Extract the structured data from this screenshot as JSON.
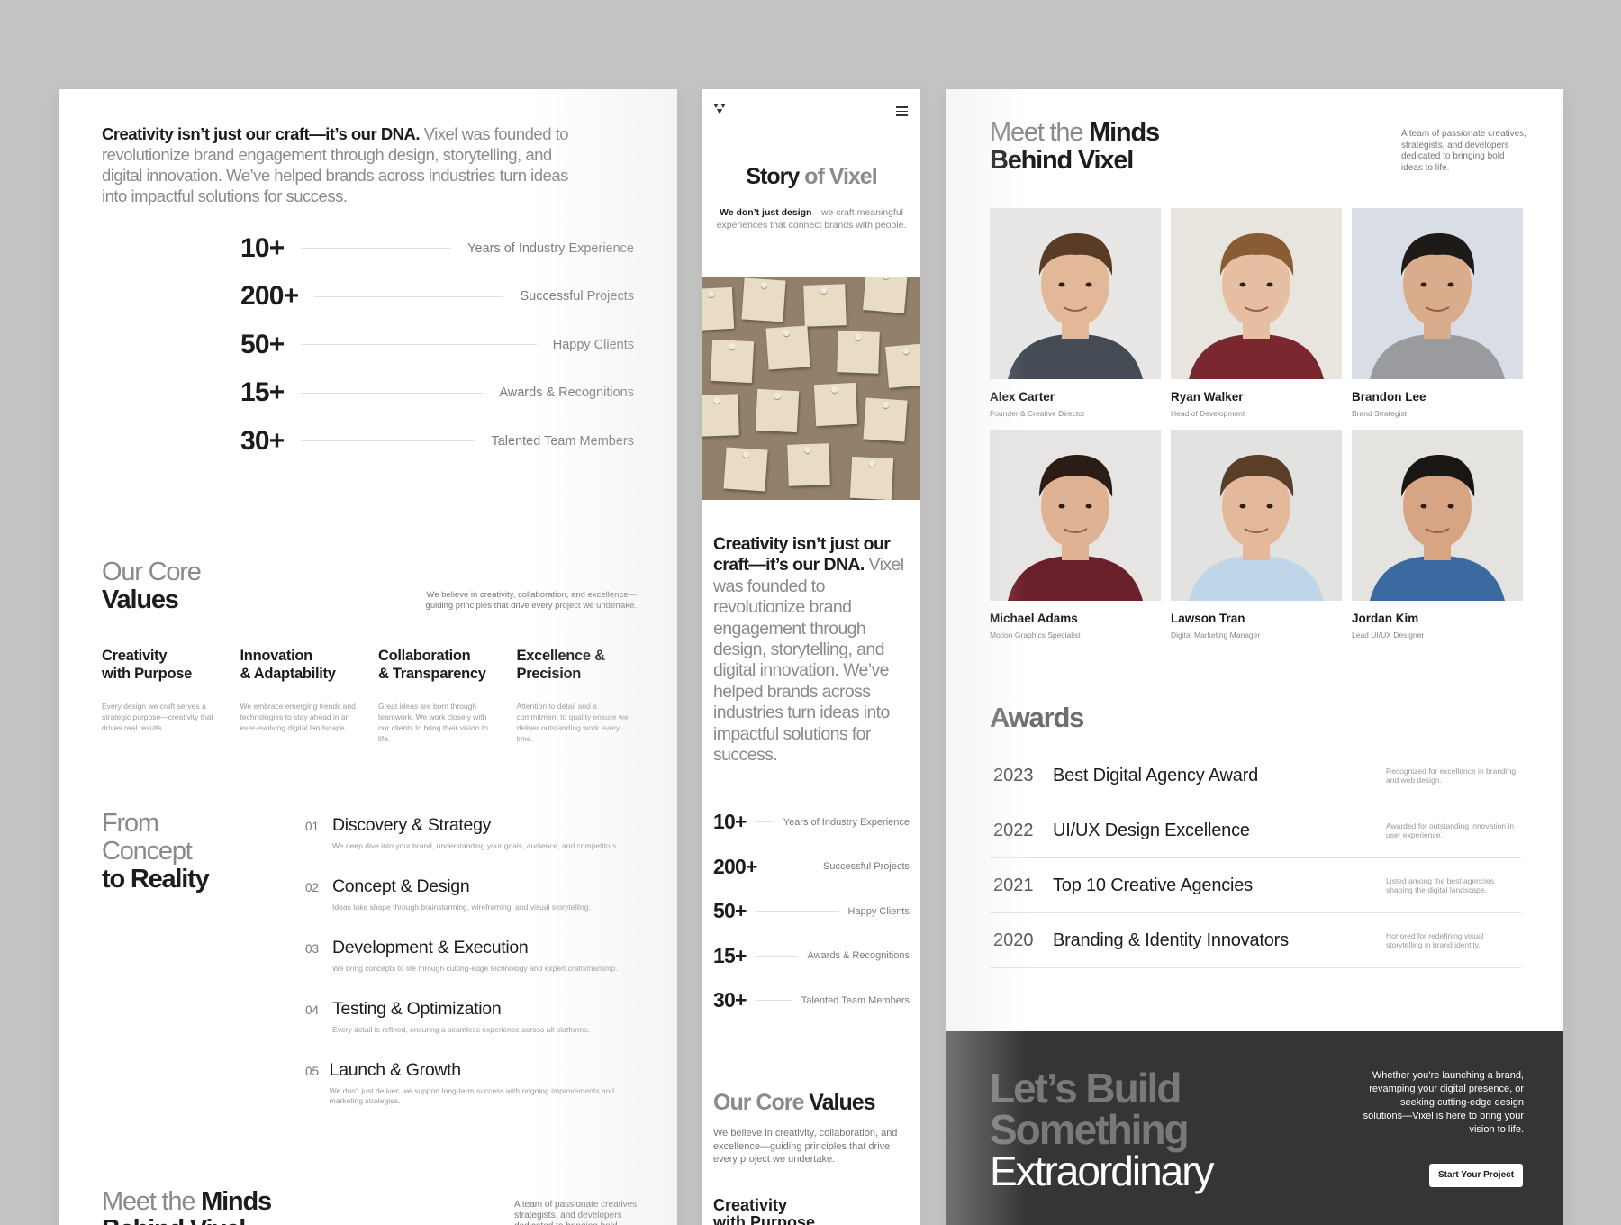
{
  "intro": {
    "bold": "Creativity isn’t just our craft—it’s our DNA.",
    "rest": " Vixel was founded to revolutionize brand engagement through design, storytelling, and digital innovation. We’ve helped brands across industries turn ideas into impactful solutions for success."
  },
  "stats": [
    {
      "value": "10+",
      "label": "Years of Industry Experience"
    },
    {
      "value": "200+",
      "label": "Successful Projects"
    },
    {
      "value": "50+",
      "label": "Happy Clients"
    },
    {
      "value": "15+",
      "label": "Awards & Recognitions"
    },
    {
      "value": "30+",
      "label": "Talented Team Members"
    }
  ],
  "core": {
    "title_light": "Our Core",
    "title_dark": "Values",
    "description": "We believe in creativity, collaboration, and excellence—guiding principles that drive every project we undertake.",
    "values": [
      {
        "line1": "Creativity",
        "line2": "with Purpose",
        "desc": "Every design we craft serves a strategic purpose—creativity that drives real results."
      },
      {
        "line1": "Innovation",
        "line2": "& Adaptability",
        "desc": "We embrace emerging trends and technologies to stay ahead in an ever-evolving digital landscape."
      },
      {
        "line1": "Collaboration",
        "line2": "& Transparency",
        "desc": "Great ideas are born through teamwork. We work closely with our clients to bring their vision to life."
      },
      {
        "line1": "Excellence &",
        "line2": "Precision",
        "desc": "Attention to detail and a commitment to quality ensure we deliver outstanding work every time."
      }
    ]
  },
  "process": {
    "title_l1": "From",
    "title_l2": "Concept",
    "title_l3": "to Reality",
    "steps": [
      {
        "num": "01",
        "title": "Discovery & Strategy",
        "desc": "We deep dive into your brand, understanding your goals, audience, and competitors."
      },
      {
        "num": "02",
        "title": "Concept & Design",
        "desc": "Ideas take shape through brainstorming, wireframing, and visual storytelling."
      },
      {
        "num": "03",
        "title": "Development & Execution",
        "desc": "We bring concepts to life through cutting-edge technology and expert craftsmanship."
      },
      {
        "num": "04",
        "title": "Testing & Optimization",
        "desc": "Every detail is refined, ensuring a seamless experience across all platforms."
      },
      {
        "num": "05",
        "title": "Launch & Growth",
        "desc": "We don’t just deliver; we support long-term success with ongoing improvements and marketing strategies."
      }
    ]
  },
  "team": {
    "title_light": "Meet the",
    "title_dark1": "Minds",
    "title_dark2": "Behind Vixel",
    "description": "A team of passionate creatives, strategists, and developers dedicated to bringing bold ideas to life.",
    "members": [
      {
        "name": "Alex Carter",
        "role": "Founder & Creative Director",
        "bg": "#e8e7e5",
        "skin": "#e3b898",
        "hair": "#5a3b26",
        "shirt": "#454b55"
      },
      {
        "name": "Ryan Walker",
        "role": "Head of Development",
        "bg": "#e8e4de",
        "skin": "#e6bfa3",
        "hair": "#8a5c35",
        "shirt": "#7a2730"
      },
      {
        "name": "Brandon Lee",
        "role": "Brand Strategist",
        "bg": "#d9dde6",
        "skin": "#d9ad8c",
        "hair": "#1e1a18",
        "shirt": "#9a9b9e"
      },
      {
        "name": "Michael Adams",
        "role": "Motion Graphics Specialist",
        "bg": "#e6e5e3",
        "skin": "#e0b294",
        "hair": "#2b1d16",
        "shirt": "#6b1f2a"
      },
      {
        "name": "Lawson Tran",
        "role": "Digital Marketing Manager",
        "bg": "#e2e2e1",
        "skin": "#e4b99b",
        "hair": "#5b3e2a",
        "shirt": "#bfd6e8"
      },
      {
        "name": "Jordan Kim",
        "role": "Lead UI/UX Designer",
        "bg": "#e5e3df",
        "skin": "#d7a583",
        "hair": "#1a1614",
        "shirt": "#3b6aa0"
      }
    ]
  },
  "awards": {
    "title": "Awards",
    "items": [
      {
        "year": "2023",
        "title": "Best Digital Agency Award",
        "desc": "Recognized for excellence in branding and web design."
      },
      {
        "year": "2022",
        "title": "UI/UX Design Excellence",
        "desc": "Awarded for outstanding innovation in user experience."
      },
      {
        "year": "2021",
        "title": "Top 10 Creative Agencies",
        "desc": "Listed among the best agencies shaping the digital landscape."
      },
      {
        "year": "2020",
        "title": "Branding & Identity Innovators",
        "desc": "Honored for redefining visual storytelling in brand identity."
      }
    ]
  },
  "cta": {
    "line1": "Let’s Build",
    "line2": "Something",
    "line3": "Extraordinary",
    "description": "Whether you’re launching a brand, revamping your digital presence, or seeking cutting-edge design solutions—Vixel is here to bring your vision to life.",
    "button": "Start Your Project"
  },
  "mobile": {
    "logo_icon": "vixel-logo-icon",
    "menu_icon": "hamburger-menu-icon",
    "story_title_dark": "Story",
    "story_title_light": " of Vixel",
    "story_desc_bold": "We don’t just design",
    "story_desc_rest": "—we craft meaningful experiences that connect brands with people.",
    "core_title_light": "Our Core",
    "core_title_dark": " Values",
    "core_desc": "We believe in creativity, collaboration, and excellence—guiding principles that drive every project we undertake.",
    "first_value_l1": "Creativity",
    "first_value_l2": "with Purpose"
  }
}
